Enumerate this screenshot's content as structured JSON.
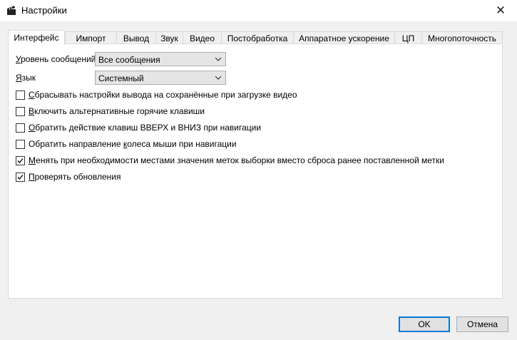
{
  "window": {
    "title": "Настройки",
    "close_glyph": "✕"
  },
  "tabs": [
    {
      "label": "Интерфейс",
      "active": true
    },
    {
      "label": "Импорт"
    },
    {
      "label": "Вывод"
    },
    {
      "label": "Звук"
    },
    {
      "label": "Видео"
    },
    {
      "label": "Постобработка"
    },
    {
      "label": "Аппаратное ускорение"
    },
    {
      "label": "ЦП"
    },
    {
      "label": "Многопоточность"
    }
  ],
  "interface": {
    "message_level": {
      "label_u": "У",
      "label_rest": "ровень сообщений:",
      "value": "Все сообщения"
    },
    "language": {
      "label_u": "Я",
      "label_rest": "зык",
      "value": "Системный"
    },
    "options": [
      {
        "pre": "",
        "u": "С",
        "post": "брасывать настройки вывода на сохранённые при загрузке видео",
        "checked": false
      },
      {
        "pre": "",
        "u": "В",
        "post": "ключить альтернативные горячие клавиши",
        "checked": false
      },
      {
        "pre": "",
        "u": "О",
        "post": "братить действие клавиш ВВЕРХ и ВНИЗ при навигации",
        "checked": false
      },
      {
        "pre": "Обратить направление ",
        "u": "к",
        "post": "олеса мыши при навигации",
        "checked": false
      },
      {
        "pre": "",
        "u": "М",
        "post": "енять при необходимости местами значения меток выборки вместо сброса ранее поставленной метки",
        "checked": true
      },
      {
        "pre": "",
        "u": "П",
        "post": "роверять обновления",
        "checked": true
      }
    ]
  },
  "buttons": {
    "ok": "OK",
    "cancel": "Отмена"
  },
  "colors": {
    "accent": "#0078d7",
    "panel_border": "#d9d9d9"
  }
}
